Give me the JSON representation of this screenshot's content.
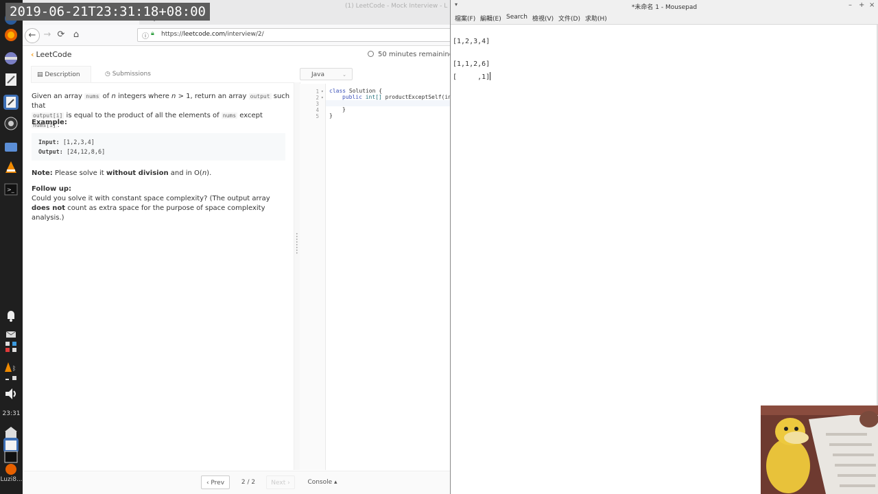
{
  "overlay": {
    "timestamp": "2019-06-21T23:31:18+08:00"
  },
  "dock": {
    "clock": "23:31",
    "user_label": "Luzi8..."
  },
  "browser": {
    "window_title": "(1) LeetCode - Mock Interview - L",
    "tab_title": "(1) LeetCode - Mock Intervi...",
    "tab_close": "×",
    "new_tab": "+",
    "url_protocol": "https://",
    "url_domain": "leetcode.com",
    "url_path": "/interview/2/",
    "nav": {
      "back": "←",
      "forward": "→",
      "reload": "⟳",
      "home": "⌂"
    }
  },
  "leetcode": {
    "logo_text": "LeetCode",
    "timer_text": "50 minutes remaining",
    "tabs": [
      {
        "label": "Description"
      },
      {
        "label": "Submissions"
      }
    ],
    "description": {
      "p1_a": "Given an array ",
      "p1_nums": "nums",
      "p1_b": " of ",
      "p1_n": "n",
      "p1_c": " integers where ",
      "p1_cond": "n",
      "p1_gt": " > 1",
      "p1_d": ",  return an array ",
      "p1_output": "output",
      "p1_e": " such that",
      "p2_output_i": "output[i]",
      "p2_a": " is equal to the product of all the elements of ",
      "p2_nums": "nums",
      "p2_b": " except ",
      "p2_nums_i": "nums[i]",
      "p2_c": ".",
      "example_heading": "Example:",
      "example_input_label": "Input:",
      "example_input": "[1,2,3,4]",
      "example_output_label": "Output:",
      "example_output": "[24,12,8,6]",
      "note_label": "Note:",
      "note_a": " Please solve it ",
      "note_bold": "without division",
      "note_b": " and in O(",
      "note_n": "n",
      "note_c": ").",
      "follow_heading": "Follow up:",
      "follow_a": "Could you solve it with constant space complexity? (The output array ",
      "follow_bold": "does not",
      "follow_b": " count as extra space for the purpose of space complexity analysis.)"
    },
    "editor": {
      "language": "Java",
      "line_numbers": [
        "1",
        "2",
        "3",
        "4",
        "5"
      ],
      "code": {
        "l1_kw": "class",
        "l1_rest": " Solution {",
        "l2_kw": "public",
        "l2_ty": " int[]",
        "l2_rest": " productExceptSelf(int",
        "l4": "}",
        "l5": "}"
      }
    },
    "bottom": {
      "prev": "‹ Prev",
      "pager": "2 / 2",
      "next": "Next ›",
      "console": "Console ▴"
    }
  },
  "mousepad": {
    "title": "*未命名 1 - Mousepad",
    "menus": [
      "檔案(F)",
      "編輯(E)",
      "Search",
      "檢視(V)",
      "文件(D)",
      "求助(H)"
    ],
    "lines": [
      "[1,2,3,4]",
      "[1,1,2,6]",
      "[     ,1]"
    ],
    "window_buttons": {
      "minimize": "–",
      "maximize": "+",
      "close": "×"
    }
  },
  "colors": {
    "leetcode_orange": "#f89f1b",
    "dock_bg": "#1f1f1f",
    "firefox_orange": "#e66000"
  }
}
